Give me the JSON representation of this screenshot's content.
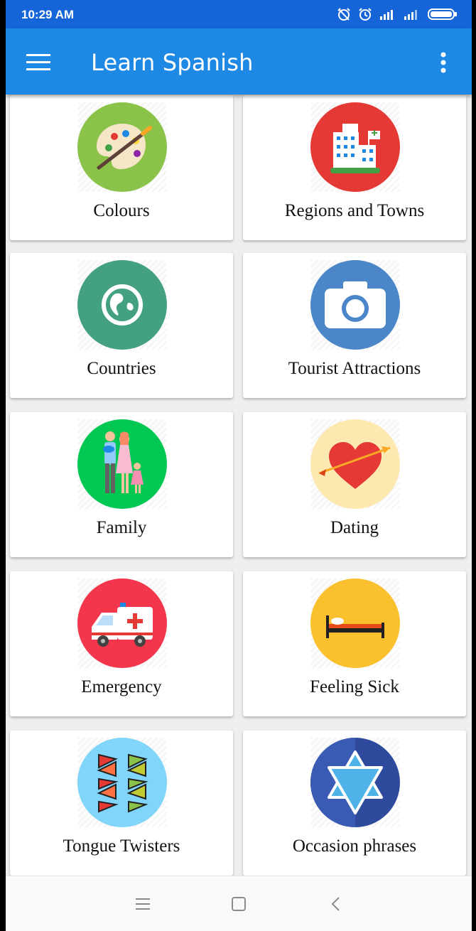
{
  "status_bar": {
    "time": "10:29 AM",
    "icons": [
      "alarm-off-icon",
      "alarm-icon",
      "signal-icon",
      "signal-icon",
      "battery-icon"
    ]
  },
  "app_bar": {
    "title": "Learn Spanish",
    "menu_icon": "hamburger-menu-icon",
    "more_icon": "more-vertical-icon",
    "color": "#1e88e5",
    "status_color": "#1565d8"
  },
  "categories": [
    {
      "label": "Colours",
      "icon": "palette-icon",
      "color": "#8bc34a"
    },
    {
      "label": "Regions and Towns",
      "icon": "buildings-icon",
      "color": "#e53935"
    },
    {
      "label": "Countries",
      "icon": "globe-icon",
      "color": "#43a080"
    },
    {
      "label": "Tourist Attractions",
      "icon": "camera-icon",
      "color": "#4a86c8"
    },
    {
      "label": "Family",
      "icon": "family-icon",
      "color": "#00c853"
    },
    {
      "label": "Dating",
      "icon": "heart-arrow-icon",
      "color": "#fde8b0"
    },
    {
      "label": "Emergency",
      "icon": "ambulance-icon",
      "color": "#f4364c"
    },
    {
      "label": "Feeling Sick",
      "icon": "bed-icon",
      "color": "#fbc02d"
    },
    {
      "label": "Tongue Twisters",
      "icon": "twisted-tongue-icon",
      "color": "#81d4fa"
    },
    {
      "label": "Occasion phrases",
      "icon": "star-of-david-icon",
      "color": "#2e4a9c"
    }
  ],
  "nav_bar": {
    "icons": [
      "recents-icon",
      "home-icon",
      "back-icon"
    ]
  }
}
